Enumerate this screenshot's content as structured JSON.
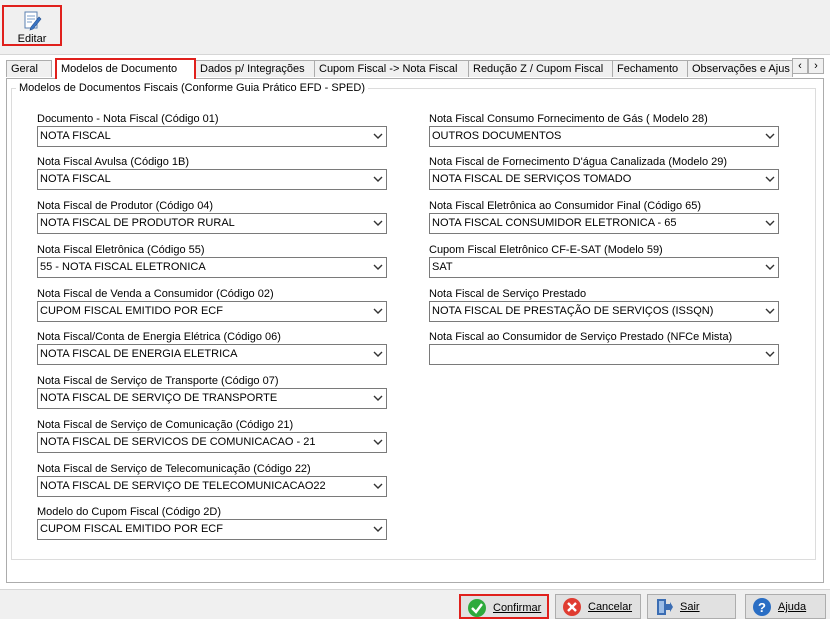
{
  "toolbar": {
    "edit_label": "Editar"
  },
  "tabs": [
    {
      "label": "Geral"
    },
    {
      "label": "Modelos de Documento"
    },
    {
      "label": "Dados p/ Integrações"
    },
    {
      "label": "Cupom Fiscal -> Nota Fiscal"
    },
    {
      "label": "Redução Z / Cupom Fiscal"
    },
    {
      "label": "Fechamento"
    },
    {
      "label": "Observações e Ajus"
    }
  ],
  "tab_nav": {
    "prev": "‹",
    "next": "›"
  },
  "group": {
    "title": "Modelos de Documentos Fiscais (Conforme Guia Prático EFD - SPED)"
  },
  "left_fields": [
    {
      "label": "Documento - Nota Fiscal (Código 01)",
      "value": "NOTA FISCAL"
    },
    {
      "label": "Nota Fiscal Avulsa (Código 1B)",
      "value": "NOTA FISCAL"
    },
    {
      "label": "Nota Fiscal de Produtor (Código 04)",
      "value": "NOTA FISCAL DE PRODUTOR RURAL"
    },
    {
      "label": "Nota Fiscal Eletrônica (Código 55)",
      "value": "55 - NOTA FISCAL ELETRONICA"
    },
    {
      "label": "Nota Fiscal de Venda a Consumidor (Código 02)",
      "value": "CUPOM FISCAL EMITIDO POR ECF"
    },
    {
      "label": "Nota Fiscal/Conta de Energia Elétrica (Código 06)",
      "value": "NOTA FISCAL DE ENERGIA ELETRICA"
    },
    {
      "label": "Nota Fiscal de Serviço de Transporte (Código 07)",
      "value": "NOTA FISCAL DE SERVIÇO DE TRANSPORTE"
    },
    {
      "label": "Nota Fiscal de Serviço de Comunicação (Código 21)",
      "value": "NOTA FISCAL DE SERVICOS DE COMUNICACAO - 21"
    },
    {
      "label": "Nota Fiscal de Serviço de Telecomunicação (Código 22)",
      "value": "NOTA FISCAL DE SERVIÇO DE TELECOMUNICACAO22"
    },
    {
      "label": "Modelo do Cupom Fiscal (Código 2D)",
      "value": "CUPOM FISCAL EMITIDO POR ECF"
    }
  ],
  "right_fields": [
    {
      "label": "Nota Fiscal Consumo Fornecimento de Gás ( Modelo 28)",
      "value": "OUTROS DOCUMENTOS"
    },
    {
      "label": "Nota Fiscal de Fornecimento D'água Canalizada (Modelo 29)",
      "value": "NOTA FISCAL DE SERVIÇOS TOMADO"
    },
    {
      "label": "Nota Fiscal Eletrônica ao Consumidor Final (Código 65)",
      "value": "NOTA FISCAL CONSUMIDOR ELETRONICA - 65"
    },
    {
      "label": "Cupom Fiscal Eletrônico CF-E-SAT (Modelo 59)",
      "value": "SAT"
    },
    {
      "label": "Nota Fiscal de Serviço Prestado",
      "value": "NOTA FISCAL DE PRESTAÇÃO DE SERVIÇOS (ISSQN)"
    },
    {
      "label": "Nota Fiscal ao Consumidor de Serviço Prestado (NFCe Mista)",
      "value": ""
    }
  ],
  "footer": {
    "confirm": "Confirmar",
    "cancel": "Cancelar",
    "exit": "Sair",
    "help": "Ajuda"
  },
  "colors": {
    "highlight": "#e0201c",
    "confirm_icon": "#2eaa3c",
    "cancel_icon": "#e03c31",
    "help_icon": "#2a6ec4"
  }
}
